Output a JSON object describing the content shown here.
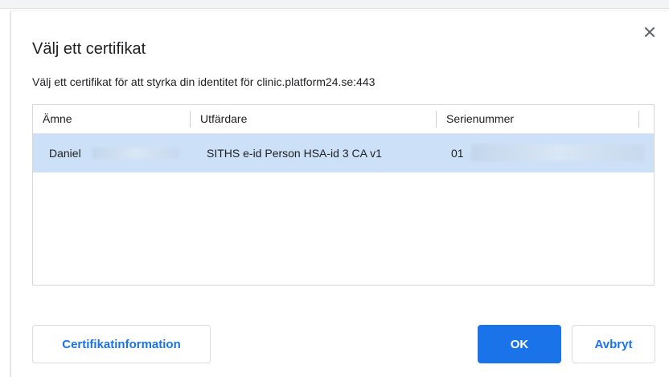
{
  "dialog": {
    "title": "Välj ett certifikat",
    "subtitle": "Välj ett certifikat för att styrka din identitet för clinic.platform24.se:443",
    "close_icon": "close-icon"
  },
  "table": {
    "columns": [
      "Ämne",
      "Utfärdare",
      "Serienummer"
    ],
    "rows": [
      {
        "subject": "Daniel",
        "issuer": "SITHS e-id Person HSA-id 3 CA v1",
        "serial": "01",
        "selected": true
      }
    ]
  },
  "buttons": {
    "info_label": "Certifikatinformation",
    "ok_label": "OK",
    "cancel_label": "Avbryt"
  },
  "colors": {
    "accent": "#1a73e8",
    "selected_row": "#cce0f7"
  }
}
